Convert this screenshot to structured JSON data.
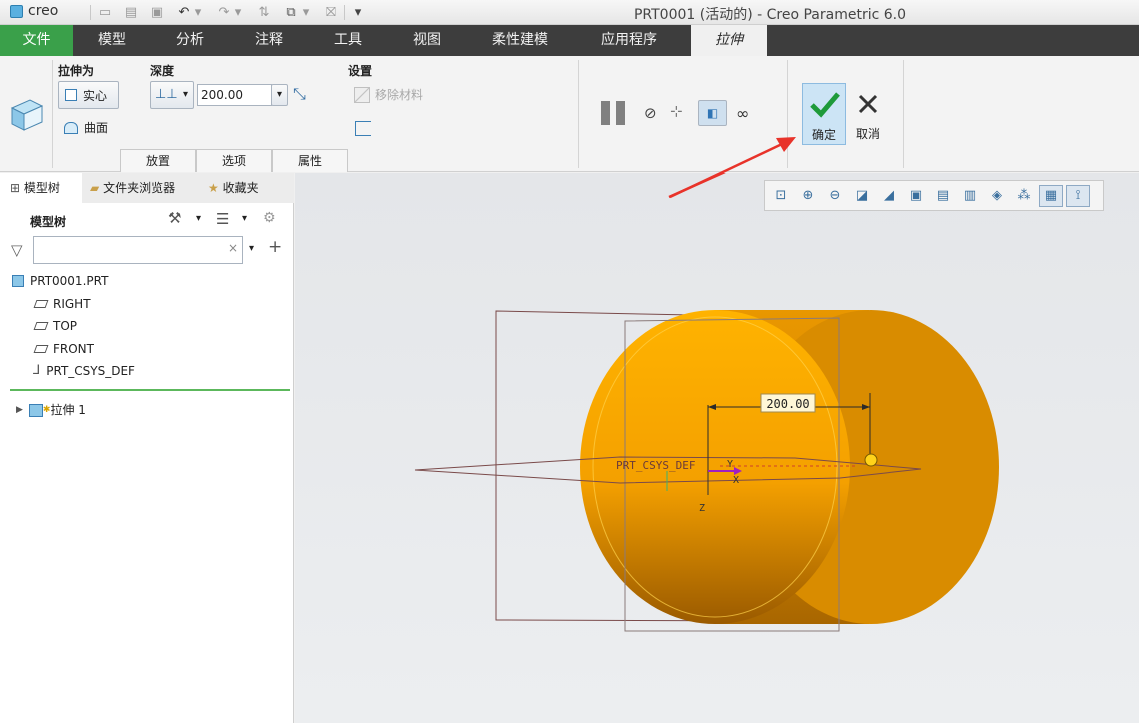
{
  "titlebar": {
    "app_logo": "creo",
    "window_title": "PRT0001 (活动的) - Creo Parametric 6.0"
  },
  "menubar": {
    "tabs": [
      "文件",
      "模型",
      "分析",
      "注释",
      "工具",
      "视图",
      "柔性建模",
      "应用程序",
      "拉伸"
    ]
  },
  "ribbon": {
    "extrude_as_label": "拉伸为",
    "solid_label": "实心",
    "surface_label": "曲面",
    "depth_label": "深度",
    "depth_value": "200.00",
    "settings_label": "设置",
    "remove_material_label": "移除材料",
    "sub_tabs": [
      "放置",
      "选项",
      "属性"
    ],
    "ok_label": "确定",
    "cancel_label": "取消"
  },
  "panel": {
    "tabs": [
      "模型树",
      "文件夹浏览器",
      "收藏夹"
    ],
    "tree_title": "模型树",
    "filter_placeholder": "",
    "clear_symbol": "×",
    "add_symbol": "+",
    "tree": {
      "root": "PRT0001.PRT",
      "planes": [
        "RIGHT",
        "TOP",
        "FRONT"
      ],
      "csys": "PRT_CSYS_DEF",
      "feature": "拉伸 1"
    }
  },
  "viewport": {
    "dimension_value": "200.00",
    "csys_label": "PRT_CSYS_DEF",
    "axis_x": "X",
    "axis_y": "Y",
    "axis_z": "Z",
    "model_color": "#f0a000",
    "arrow_color": "#e8332a"
  }
}
